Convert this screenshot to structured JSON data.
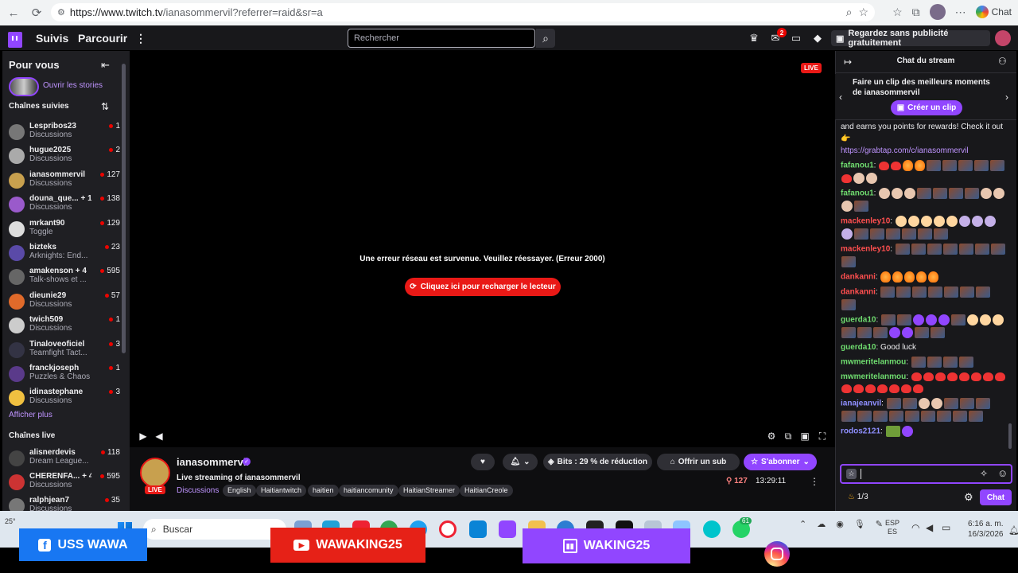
{
  "browser": {
    "url_host": "https://www.twitch.tv",
    "url_path": "/ianasommervil?referrer=raid&sr=a",
    "chat_label": "Chat"
  },
  "topnav": {
    "following": "Suivis",
    "browse": "Parcourir",
    "search_placeholder": "Rechercher",
    "notif_count": "2",
    "promo": "Regardez sans publicité gratuitement"
  },
  "sidebar": {
    "for_you": "Pour vous",
    "stories": "Ouvrir les stories",
    "followed_title": "Chaînes suivies",
    "show_more": "Afficher plus",
    "live_title": "Chaînes live",
    "followed": [
      {
        "name": "Lespribos23",
        "category": "Discussions",
        "viewers": "1",
        "color": "#777"
      },
      {
        "name": "hugue2025",
        "category": "Discussions",
        "viewers": "2",
        "color": "#aaa"
      },
      {
        "name": "ianasommervil",
        "category": "Discussions",
        "viewers": "127",
        "color": "#c8a04e"
      },
      {
        "name": "douna_que...  + 1",
        "category": "Discussions",
        "viewers": "138",
        "color": "#9a5acb"
      },
      {
        "name": "mrkant90",
        "category": "Toggle",
        "viewers": "129",
        "color": "#ddd"
      },
      {
        "name": "bizteks",
        "category": "Arknights: End...",
        "viewers": "23",
        "color": "#5a4aa8"
      },
      {
        "name": "amakenson + 4",
        "category": "Talk-shows et ...",
        "viewers": "595",
        "color": "#666"
      },
      {
        "name": "dieunie29",
        "category": "Discussions",
        "viewers": "57",
        "color": "#e06a2a"
      },
      {
        "name": "twich509",
        "category": "Discussions",
        "viewers": "1",
        "color": "#ccc"
      },
      {
        "name": "Tinaloveoficiel",
        "category": "Teamfight Tact...",
        "viewers": "3",
        "color": "#334"
      },
      {
        "name": "franckjoseph",
        "category": "Puzzles & Chaos",
        "viewers": "1",
        "color": "#5a3a8a"
      },
      {
        "name": "idinastephane",
        "category": "Discussions",
        "viewers": "3",
        "color": "#f0c040"
      }
    ],
    "live": [
      {
        "name": "alisnerdevis",
        "category": "Dream League...",
        "viewers": "118",
        "color": "#444"
      },
      {
        "name": "CHERENFA...  + 4",
        "category": "Discussions",
        "viewers": "595",
        "color": "#c33"
      },
      {
        "name": "ralphjean7",
        "category": "Discussions",
        "viewers": "35",
        "color": "#777"
      }
    ]
  },
  "player": {
    "live": "LIVE",
    "error": "Une erreur réseau est survenue. Veuillez réessayer. (Erreur 2000)",
    "reload": "Cliquez ici pour recharger le lecteur"
  },
  "stream": {
    "name": "ianasommervil",
    "title": "Live streaming of ianasommervil",
    "category": "Discussions",
    "avatar_live": "LIVE",
    "tags": [
      "English",
      "Haitiantwitch",
      "haitien",
      "haitiancomunity",
      "HaitianStreamer",
      "HaitianCreole"
    ],
    "bits": "Bits : 29 % de réduction",
    "gift": "Offrir un sub",
    "subscribe": "S'abonner",
    "viewers": "127",
    "uptime": "13:29:11"
  },
  "chat": {
    "title": "Chat du stream",
    "clip_text": "Faire un clip des meilleurs moments de ianasommervil",
    "clip_btn": "Créer un clip",
    "intro_text": "and earns you points for rewards! Check it out 👉",
    "intro_link": "https://grabtap.com/c/ianasommervil",
    "messages": [
      {
        "user": "fafanou1",
        "color": "#6fdc6f",
        "text": "",
        "emotes": [
          "e2",
          "e2",
          "e3",
          "e3",
          "e1",
          "e1",
          "e1",
          "e1",
          "e1",
          "e2",
          "e4",
          "e4"
        ]
      },
      {
        "user": "fafanou1",
        "color": "#6fdc6f",
        "text": "",
        "emotes": [
          "e4",
          "e4",
          "e4",
          "e1",
          "e1",
          "e1",
          "e1",
          "e4",
          "e4",
          "e4",
          "e1"
        ]
      },
      {
        "user": "mackenley10",
        "color": "#ff4f4f",
        "text": "",
        "emotes": [
          "e5",
          "e5",
          "e5",
          "e5",
          "e5",
          "e6",
          "e6",
          "e6",
          "e6",
          "e1",
          "e1",
          "e1",
          "e1",
          "e1",
          "e1"
        ]
      },
      {
        "user": "mackenley10",
        "color": "#ff4f4f",
        "text": "",
        "emotes": [
          "e1",
          "e1",
          "e1",
          "e1",
          "e1",
          "e1",
          "e1",
          "e1"
        ]
      },
      {
        "user": "dankanni",
        "color": "#ff4f4f",
        "text": "",
        "emotes": [
          "e3",
          "e3",
          "e3",
          "e3",
          "e3"
        ]
      },
      {
        "user": "dankanni",
        "color": "#ff4f4f",
        "text": "",
        "emotes": [
          "e1",
          "e1",
          "e1",
          "e1",
          "e1",
          "e1",
          "e1",
          "e1"
        ]
      },
      {
        "user": "guerda10",
        "color": "#6fdc6f",
        "text": "",
        "emotes": [
          "e1",
          "e1",
          "e7",
          "e7",
          "e7",
          "e1",
          "e5",
          "e5",
          "e5",
          "e1",
          "e1",
          "e1",
          "e7",
          "e7",
          "e1",
          "e1"
        ]
      },
      {
        "user": "guerda10",
        "color": "#6fdc6f",
        "text": "Good luck",
        "emotes": []
      },
      {
        "user": "mwmeritelanmou",
        "color": "#6fdc6f",
        "text": "",
        "emotes": [
          "e1",
          "e1",
          "e1",
          "e1"
        ]
      },
      {
        "user": "mwmeritelanmou",
        "color": "#6fdc6f",
        "text": "",
        "emotes": [
          "e2",
          "e2",
          "e2",
          "e2",
          "e2",
          "e2",
          "e2",
          "e2",
          "e2",
          "e2",
          "e2",
          "e2",
          "e2",
          "e2",
          "e2"
        ]
      },
      {
        "user": "ianajeanvil",
        "color": "#8f8fff",
        "text": "",
        "emotes": [
          "e1",
          "e1",
          "e4",
          "e4",
          "e1",
          "e1",
          "e1",
          "e1",
          "e1",
          "e1",
          "e1",
          "e1",
          "e1",
          "e1",
          "e1",
          "e1"
        ]
      },
      {
        "user": "rodos2121",
        "color": "#8f8fff",
        "text": "",
        "emotes": [
          "e8",
          "e7"
        ]
      }
    ],
    "points": "1/3",
    "send": "Chat"
  },
  "taskbar": {
    "temp": "25°",
    "search": "Buscar",
    "lang1": "ESP",
    "lang2": "ES",
    "time": "6:16 a. m.",
    "date": "16/3/2026",
    "badge": "61"
  },
  "overlay": {
    "facebook": "USS WAWA",
    "youtube": "WAWAKING25",
    "twitch": "WAKING25"
  }
}
